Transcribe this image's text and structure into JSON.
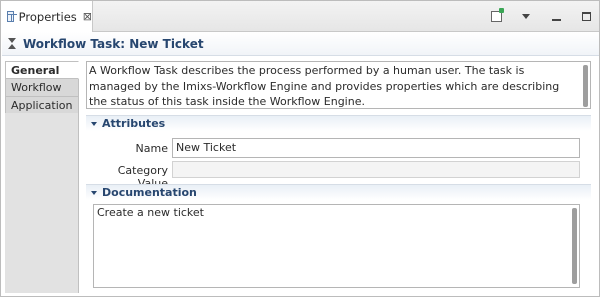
{
  "view_tab": {
    "label": "Properties",
    "close_glyph": "⊠"
  },
  "toolbar": {
    "pin_icon": "pin-editor-icon",
    "menu_icon": "view-menu-icon",
    "minimize_icon": "minimize-icon",
    "maximize_icon": "maximize-icon"
  },
  "header": {
    "icon": "hourglass-icon",
    "title": "Workflow Task: New Ticket"
  },
  "side_tabs": [
    {
      "label": "General",
      "active": true
    },
    {
      "label": "Workflow",
      "active": false
    },
    {
      "label": "Application",
      "active": false
    }
  ],
  "description": "A Workflow Task describes the process performed by a human user. The task is managed by the Imixs-Workflow Engine and provides properties which are describing the status of this task inside the Workflow Engine.",
  "attributes": {
    "title": "Attributes",
    "name_label": "Name",
    "name_value": "New Ticket",
    "category_label": "Category Value",
    "category_value": ""
  },
  "documentation": {
    "title": "Documentation",
    "value": "Create a new ticket"
  },
  "colors": {
    "section_title": "#27466f",
    "tab_inactive": "#d8d8d8"
  }
}
